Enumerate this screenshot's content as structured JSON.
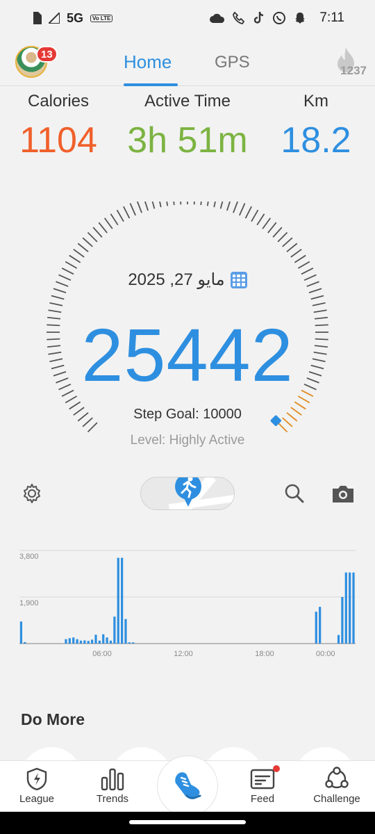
{
  "status_bar": {
    "network": "5G",
    "volte": "Vo LTE",
    "time": "7:11",
    "icons": [
      "sim-icon",
      "signal-icon",
      "cloud-icon",
      "call-icon",
      "tiktok-icon",
      "whatsapp-icon",
      "snapchat-icon"
    ]
  },
  "topnav": {
    "avatar_badge": "13",
    "tabs": [
      {
        "label": "Home",
        "active": true
      },
      {
        "label": "GPS",
        "active": false
      }
    ],
    "flame_count": "1237"
  },
  "stats": {
    "calories": {
      "label": "Calories",
      "value": "1104",
      "color": "#f0602b"
    },
    "active_time": {
      "label": "Active Time",
      "value": "3h 51m",
      "color": "#7cb342"
    },
    "km": {
      "label": "Km",
      "value": "18.2",
      "color": "#2e8fe0"
    }
  },
  "gauge": {
    "date": "مايو 27, 2025",
    "steps": "25442",
    "goal_text": "Step Goal: 10000",
    "level_text": "Level: Highly Active",
    "progress_fraction": 1.0,
    "accent": "#2e8fe0"
  },
  "tools": [
    "settings-icon",
    "run-toggle",
    "search-icon",
    "camera-icon"
  ],
  "chart_data": {
    "type": "bar",
    "y_ticks": [
      "3,800",
      "1,900"
    ],
    "ylim": [
      0,
      3800
    ],
    "x_ticks": [
      "06:00",
      "12:00",
      "18:00",
      "00:00"
    ],
    "grid": true,
    "bar_color": "#2e8fe0",
    "values": [
      900,
      60,
      0,
      0,
      0,
      0,
      0,
      0,
      0,
      0,
      0,
      0,
      180,
      220,
      250,
      180,
      120,
      130,
      110,
      160,
      360,
      120,
      380,
      250,
      120,
      1100,
      3500,
      3500,
      1000,
      50,
      50,
      0,
      0,
      0,
      0,
      0,
      0,
      0,
      0,
      0,
      0,
      0,
      0,
      0,
      0,
      0,
      0,
      0,
      0,
      0,
      0,
      0,
      0,
      0,
      0,
      0,
      0,
      0,
      0,
      0,
      0,
      0,
      0,
      0,
      0,
      0,
      0,
      0,
      0,
      0,
      0,
      0,
      0,
      0,
      0,
      0,
      0,
      0,
      0,
      1300,
      1500,
      0,
      0,
      0,
      0,
      350,
      1900,
      2900,
      2900,
      2900
    ]
  },
  "do_more": {
    "title": "Do More"
  },
  "bottomnav": {
    "items": [
      {
        "label": "League",
        "icon": "bolt-shield-icon"
      },
      {
        "label": "Trends",
        "icon": "bar-chart-icon"
      },
      {
        "label": "",
        "icon": "shoe-icon"
      },
      {
        "label": "Feed",
        "icon": "feed-icon"
      },
      {
        "label": "Challenge",
        "icon": "challenge-icon"
      }
    ]
  }
}
